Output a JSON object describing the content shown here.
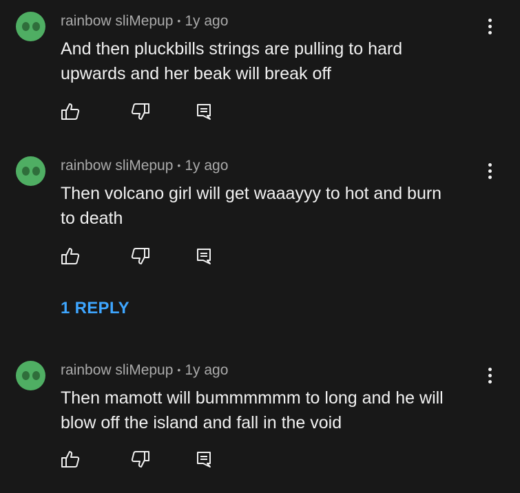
{
  "comments": [
    {
      "author": "rainbow sliMepup",
      "separator": "•",
      "time": "1y ago",
      "text": "And then pluckbills strings are pulling to hard\nupwards and her beak will break off"
    },
    {
      "author": "rainbow sliMepup",
      "separator": "•",
      "time": "1y ago",
      "text": "Then volcano girl will get waaayyy to hot and burn\nto death"
    },
    {
      "author": "rainbow sliMepup",
      "separator": "•",
      "time": "1y ago",
      "text": "Then mamott will bummmmmm to long and he will\nblow off the island and fall in the void"
    }
  ],
  "replies_link": "1 REPLY",
  "icons": {
    "like": "thumbs-up-icon",
    "dislike": "thumbs-down-icon",
    "reply": "reply-comment-icon",
    "more": "more-vertical-icon"
  },
  "colors": {
    "background": "#181818",
    "text": "#f1f1f1",
    "meta": "#aaaaaa",
    "link": "#3ea6ff",
    "avatar": "#4fae63"
  }
}
